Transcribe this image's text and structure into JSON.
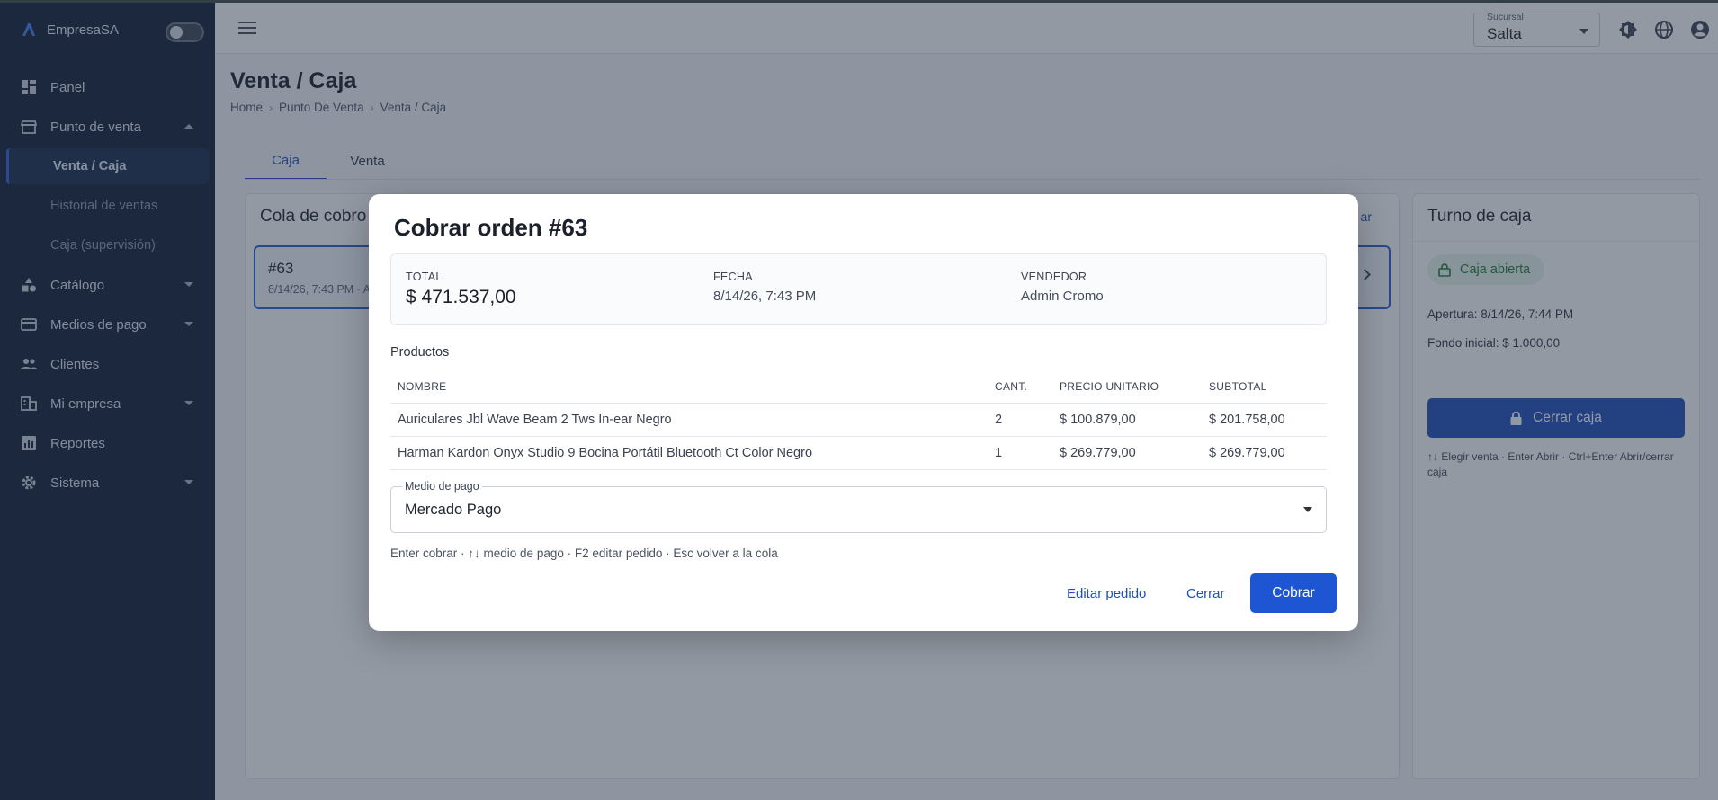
{
  "sidebar": {
    "brand": "EmpresaSA",
    "items": [
      {
        "label": "Panel",
        "icon": "dashboard-icon"
      },
      {
        "label": "Punto de venta",
        "icon": "store-icon",
        "expanded": true,
        "children": [
          "Venta / Caja",
          "Historial de ventas",
          "Caja (supervisión)"
        ],
        "active_child": "Venta / Caja"
      },
      {
        "label": "Catálogo",
        "icon": "category-icon"
      },
      {
        "label": "Medios de pago",
        "icon": "credit-card-icon"
      },
      {
        "label": "Clientes",
        "icon": "people-icon"
      },
      {
        "label": "Mi empresa",
        "icon": "building-icon"
      },
      {
        "label": "Reportes",
        "icon": "report-icon"
      },
      {
        "label": "Sistema",
        "icon": "gear-icon"
      }
    ]
  },
  "topbar": {
    "branch_label": "Sucursal",
    "branch_value": "Salta",
    "icons": [
      "theme-icon",
      "language-icon",
      "account-icon"
    ]
  },
  "page": {
    "title": "Venta / Caja",
    "breadcrumb": [
      "Home",
      "Punto De Venta",
      "Venta / Caja"
    ],
    "tabs": [
      "Caja",
      "Venta"
    ],
    "active_tab": "Caja"
  },
  "queue": {
    "title": "Cola de cobro",
    "action": "ar",
    "item": {
      "id": "#63",
      "meta": "8/14/26, 7:43 PM · A"
    }
  },
  "shift": {
    "title": "Turno de caja",
    "status": "Caja abierta",
    "opening": "Apertura: 8/14/26, 7:44 PM",
    "initial_fund": "Fondo inicial: $ 1.000,00",
    "close_button": "Cerrar caja",
    "hint": "↑↓ Elegir venta · Enter Abrir · Ctrl+Enter Abrir/cerrar caja"
  },
  "modal": {
    "title": "Cobrar orden #63",
    "summary": {
      "total_label": "TOTAL",
      "total_value": "$ 471.537,00",
      "date_label": "FECHA",
      "date_value": "8/14/26, 7:43 PM",
      "seller_label": "VENDEDOR",
      "seller_value": "Admin Cromo"
    },
    "products_label": "Productos",
    "columns": [
      "NOMBRE",
      "CANT.",
      "PRECIO UNITARIO",
      "SUBTOTAL"
    ],
    "rows": [
      [
        "Auriculares Jbl Wave Beam 2 Tws In-ear Negro",
        "2",
        "$ 100.879,00",
        "$ 201.758,00"
      ],
      [
        "Harman Kardon Onyx Studio 9 Bocina Portátil Bluetooth Ct Color Negro",
        "1",
        "$ 269.779,00",
        "$ 269.779,00"
      ]
    ],
    "payment_label": "Medio de pago",
    "payment_value": "Mercado Pago",
    "hint": "Enter cobrar · ↑↓ medio de pago · F2 editar pedido · Esc volver a la cola",
    "buttons": {
      "edit": "Editar pedido",
      "close": "Cerrar",
      "charge": "Cobrar"
    }
  },
  "colors": {
    "sidebar_bg": "#0f1d33",
    "accent": "#1f4fb8",
    "primary_button": "#1e55d3",
    "status_green": "#237a3b"
  }
}
